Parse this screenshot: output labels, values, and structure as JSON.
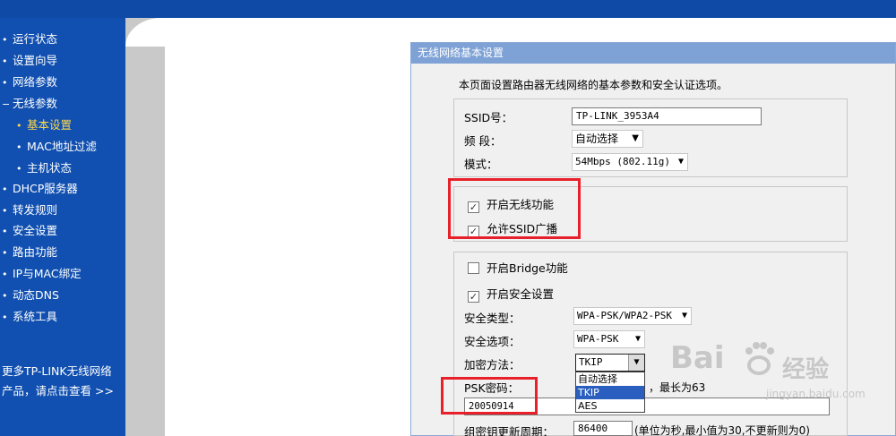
{
  "sidebar": {
    "items": [
      {
        "bullet": "•",
        "label": "运行状态"
      },
      {
        "bullet": "•",
        "label": "设置向导"
      },
      {
        "bullet": "•",
        "label": "网络参数"
      },
      {
        "bullet": "−",
        "label": "无线参数"
      },
      {
        "bullet": "•",
        "label": "基本设置"
      },
      {
        "bullet": "•",
        "label": "MAC地址过滤"
      },
      {
        "bullet": "•",
        "label": "主机状态"
      },
      {
        "bullet": "•",
        "label": "DHCP服务器"
      },
      {
        "bullet": "•",
        "label": "转发规则"
      },
      {
        "bullet": "•",
        "label": "安全设置"
      },
      {
        "bullet": "•",
        "label": "路由功能"
      },
      {
        "bullet": "•",
        "label": "IP与MAC绑定"
      },
      {
        "bullet": "•",
        "label": "动态DNS"
      },
      {
        "bullet": "•",
        "label": "系统工具"
      }
    ],
    "footer_line1": "更多TP-LINK无线网络",
    "footer_line2": "产品，请点击查看 >>"
  },
  "panel": {
    "title": "无线网络基本设置",
    "description": "本页面设置路由器无线网络的基本参数和安全认证选项。",
    "ssid_label": "SSID号：",
    "ssid_value": "TP-LINK_3953A4",
    "band_label": "频 段：",
    "band_value": "自动选择",
    "mode_label": "模式：",
    "mode_value": "54Mbps (802.11g)",
    "enable_wireless": "开启无线功能",
    "allow_ssid_broadcast": "允许SSID广播",
    "enable_bridge": "开启Bridge功能",
    "enable_security": "开启安全设置",
    "security_type_label": "安全类型：",
    "security_type_value": "WPA-PSK/WPA2-PSK",
    "security_option_label": "安全选项：",
    "security_option_value": "WPA-PSK",
    "encryption_label": "加密方法：",
    "encryption_value": "TKIP",
    "encryption_options": [
      "自动选择",
      "TKIP",
      "AES"
    ],
    "psk_label": "PSK密码：",
    "psk_hint": "，最长为63",
    "psk_value": "20050914",
    "rekey_label": "组密钥更新周期：",
    "rekey_value": "86400",
    "rekey_hint": "(单位为秒,最小值为30,不更新则为0)"
  },
  "watermark": {
    "brand": "Bai",
    "brand2": "经验",
    "url": "jingyan.baidu.com"
  },
  "colors": {
    "sidebar_bg": "#1150b0",
    "active_item": "#ffd84a",
    "panel_header": "#7ea2d6",
    "highlight_box": "#e8202a"
  }
}
